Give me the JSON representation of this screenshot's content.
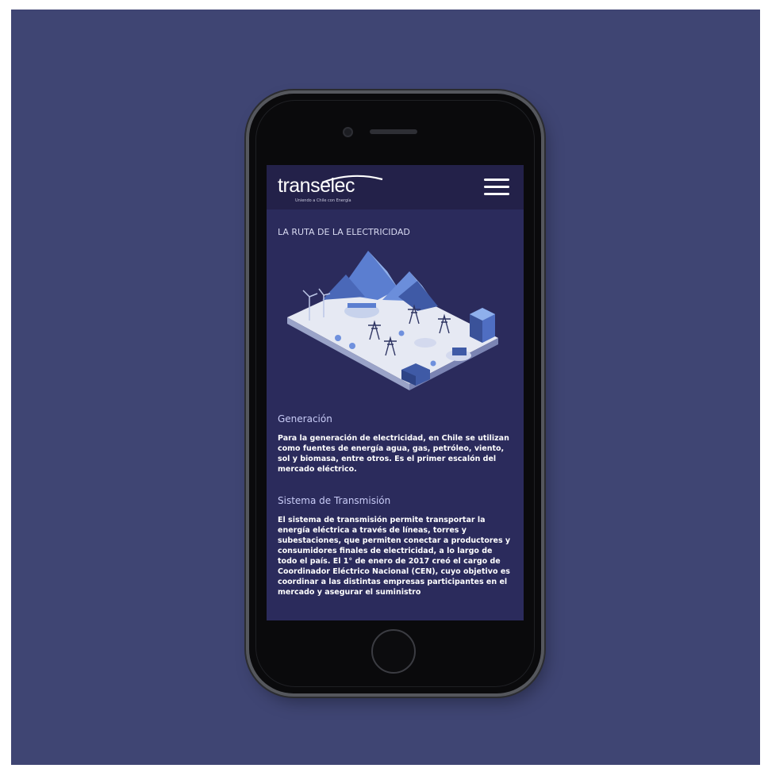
{
  "app": {
    "logo_text": "transelec",
    "logo_tagline": "Uniendo a Chile con Energía"
  },
  "page": {
    "title": "LA RUTA DE LA ELECTRICIDAD"
  },
  "sections": [
    {
      "heading": "Generación",
      "body": "Para la generación de electricidad, en Chile se utilizan como fuentes de energía agua, gas, petróleo, viento, sol y biomasa, entre otros. Es el primer escalón del mercado eléctrico."
    },
    {
      "heading": "Sistema de Transmisión",
      "body": "El sistema de transmisión permite transportar la energía eléctrica a través de líneas, torres y subestaciones, que permiten conectar a productores y consumidores finales de electricidad, a lo largo de todo el país. El 1° de enero de 2017 creó el cargo de Coordinador Eléctrico Nacional (CEN), cuyo objetivo es coordinar a las distintas empresas participantes en el mercado y asegurar el suministro"
    }
  ],
  "icons": {
    "menu": "hamburger-menu-icon",
    "illustration": "electricity-grid-illustration"
  },
  "colors": {
    "backdrop": "#3f4573",
    "screen_bg": "#2b2b5c",
    "header_bg": "#232149",
    "heading": "#c9ccf7",
    "text": "#ffffff"
  }
}
